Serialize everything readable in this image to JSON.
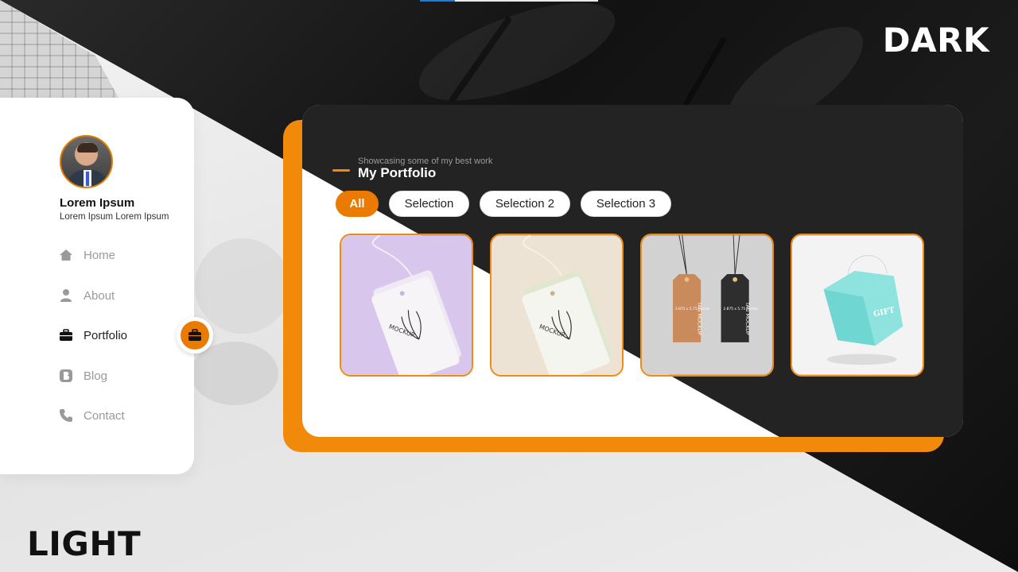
{
  "labels": {
    "dark": "DARK",
    "light": "LIGHT"
  },
  "profile": {
    "name": "Lorem Ipsum",
    "subtitle": "Lorem Ipsum Lorem Ipsum"
  },
  "nav": [
    {
      "label": "Home",
      "icon": "home-icon"
    },
    {
      "label": "About",
      "icon": "user-icon"
    },
    {
      "label": "Portfolio",
      "icon": "briefcase-icon",
      "active": true
    },
    {
      "label": "Blog",
      "icon": "blog-icon"
    },
    {
      "label": "Contact",
      "icon": "phone-icon"
    }
  ],
  "portfolio": {
    "subtitle": "Showcasing some of my best work",
    "title": "My Portfolio",
    "filters": [
      {
        "label": "All",
        "active": true
      },
      {
        "label": "Selection"
      },
      {
        "label": "Selection 2"
      },
      {
        "label": "Selection 3"
      }
    ],
    "items": [
      {
        "name": "Hang tag mockup lavender",
        "tag_text": "MOCKUP"
      },
      {
        "name": "Hang tag mockup beige",
        "tag_text": "MOCKUP"
      },
      {
        "name": "Tag mockup pair",
        "tag_text": "TAG MOCKUP",
        "dims": "2.875 x 5.75 inches"
      },
      {
        "name": "Gift box mockup",
        "tag_text": "GIFT"
      }
    ]
  },
  "colors": {
    "accent": "#f18a0a",
    "dark_panel": "#232323",
    "sidebar": "#ffffff"
  }
}
